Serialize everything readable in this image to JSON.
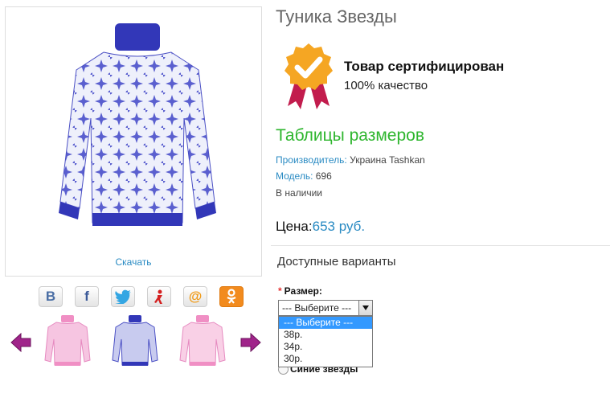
{
  "product": {
    "title": "Туника Звезды",
    "download_label": "Скачать",
    "cert_title": "Товар сертифицирован",
    "cert_sub": "100% качество",
    "size_tables_label": "Таблицы размеров",
    "manufacturer_key": "Производитель:",
    "manufacturer_value": "Украина Tashkan",
    "model_key": "Модель:",
    "model_value": "696",
    "stock": "В наличии",
    "price_label": "Цена:",
    "price_value": "653 руб."
  },
  "share": {
    "vk": "В",
    "facebook": "f",
    "twitter_icon": "twitter-bird-icon",
    "odnoklassniki_alt_icon": "ya-icon",
    "mail": "@",
    "ok_icon": "odnoklassniki-icon"
  },
  "variants": {
    "heading": "Доступные варианты",
    "required_mark": "*",
    "size_label": "Размер:",
    "select_value": "--- Выберите ---",
    "options": [
      "--- Выберите ---",
      "38р.",
      "34р.",
      "30р."
    ],
    "color_option": "Синие звезды"
  },
  "colors": {
    "link_blue": "#2a8bc3",
    "green": "#2fb62f",
    "sweater_blue": "#4a4fc4",
    "sweater_pink": "#f2a4cf",
    "arrow_purple": "#a0248a",
    "badge_orange": "#f5a623",
    "badge_ribbon": "#c21c4d"
  }
}
